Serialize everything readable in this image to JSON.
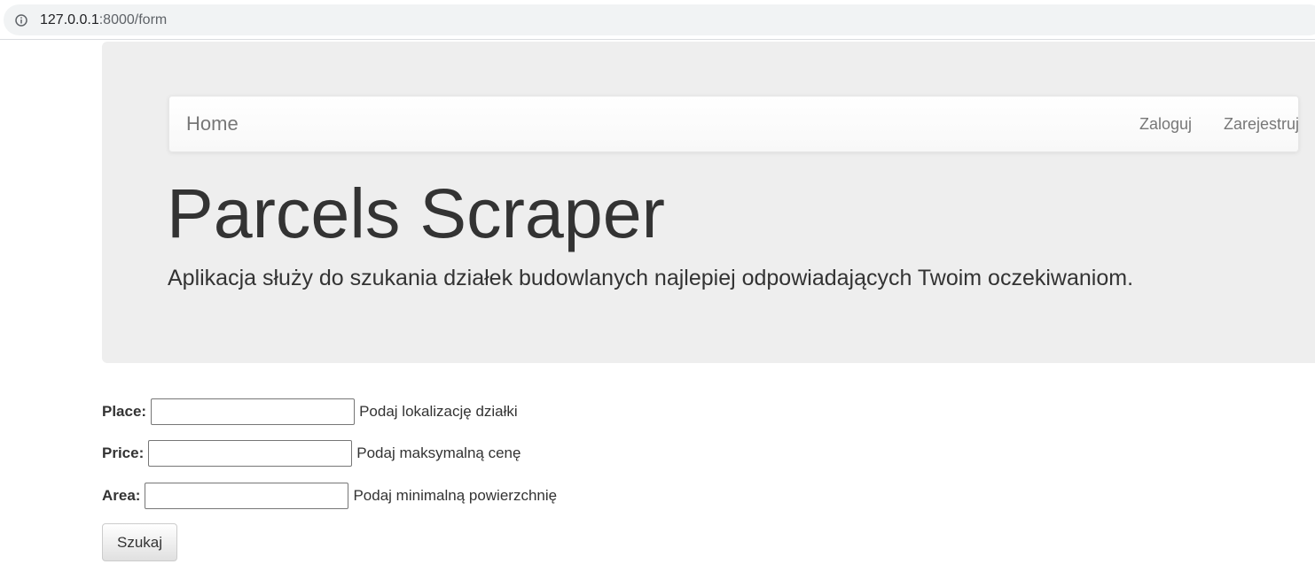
{
  "browser": {
    "url_host": "127.0.0.1",
    "url_rest": ":8000/form",
    "info_icon": "info-circle-icon"
  },
  "navbar": {
    "brand": "Home",
    "links": [
      {
        "label": "Zaloguj"
      },
      {
        "label": "Zarejestruj"
      }
    ]
  },
  "jumbotron": {
    "title": "Parcels Scraper",
    "lead": "Aplikacja służy do szukania działek budowlanych najlepiej odpowiadających Twoim oczekiwaniom."
  },
  "form": {
    "fields": [
      {
        "label": "Place:",
        "value": "",
        "help": "Podaj lokalizację działki"
      },
      {
        "label": "Price:",
        "value": "",
        "help": "Podaj maksymalną cenę"
      },
      {
        "label": "Area:",
        "value": "",
        "help": "Podaj minimalną powierzchnię"
      }
    ],
    "submit_label": "Szukaj"
  },
  "colors": {
    "jumbotron_bg": "#eeeeee",
    "nav_text": "#777777",
    "body_text": "#333333"
  }
}
